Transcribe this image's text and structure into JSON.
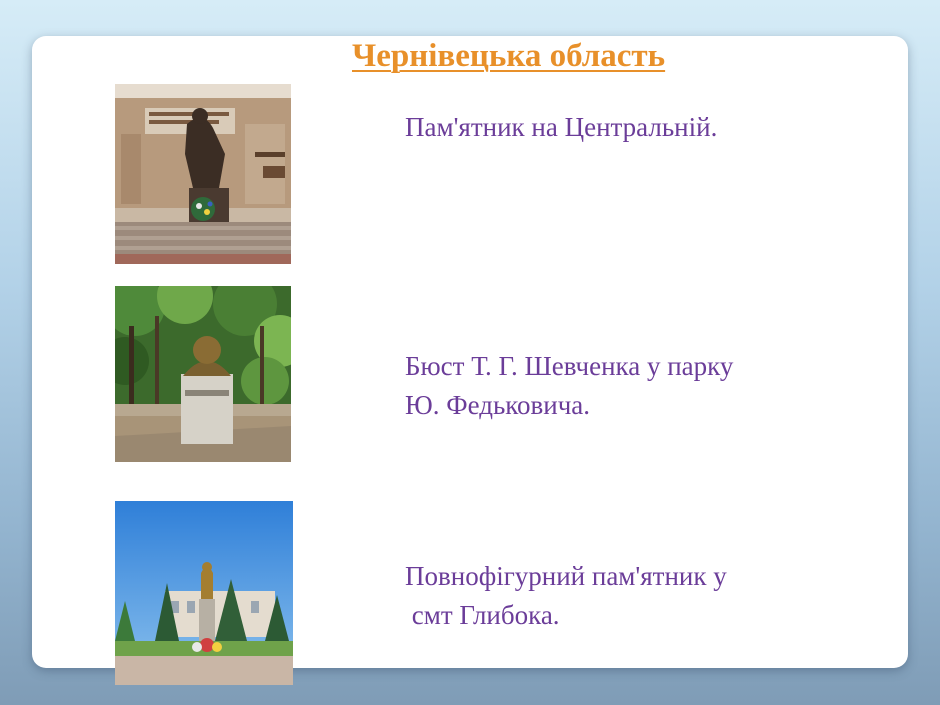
{
  "slide": {
    "title": "Чернівецька  область",
    "items": [
      {
        "caption": "Пам'ятник на Центральній.",
        "photo_icon": "monument-central-square-photo"
      },
      {
        "caption": "Бюст Т. Г. Шевченка у парку\nЮ. Федьковича.",
        "photo_icon": "shevchenko-bust-park-photo"
      },
      {
        "caption": "Повнофігурний пам'ятник у\n смт Глибока.",
        "photo_icon": "full-figure-monument-hlyboka-photo"
      }
    ]
  },
  "colors": {
    "title": "#e8902a",
    "caption": "#6b3d99",
    "card": "#ffffff"
  }
}
